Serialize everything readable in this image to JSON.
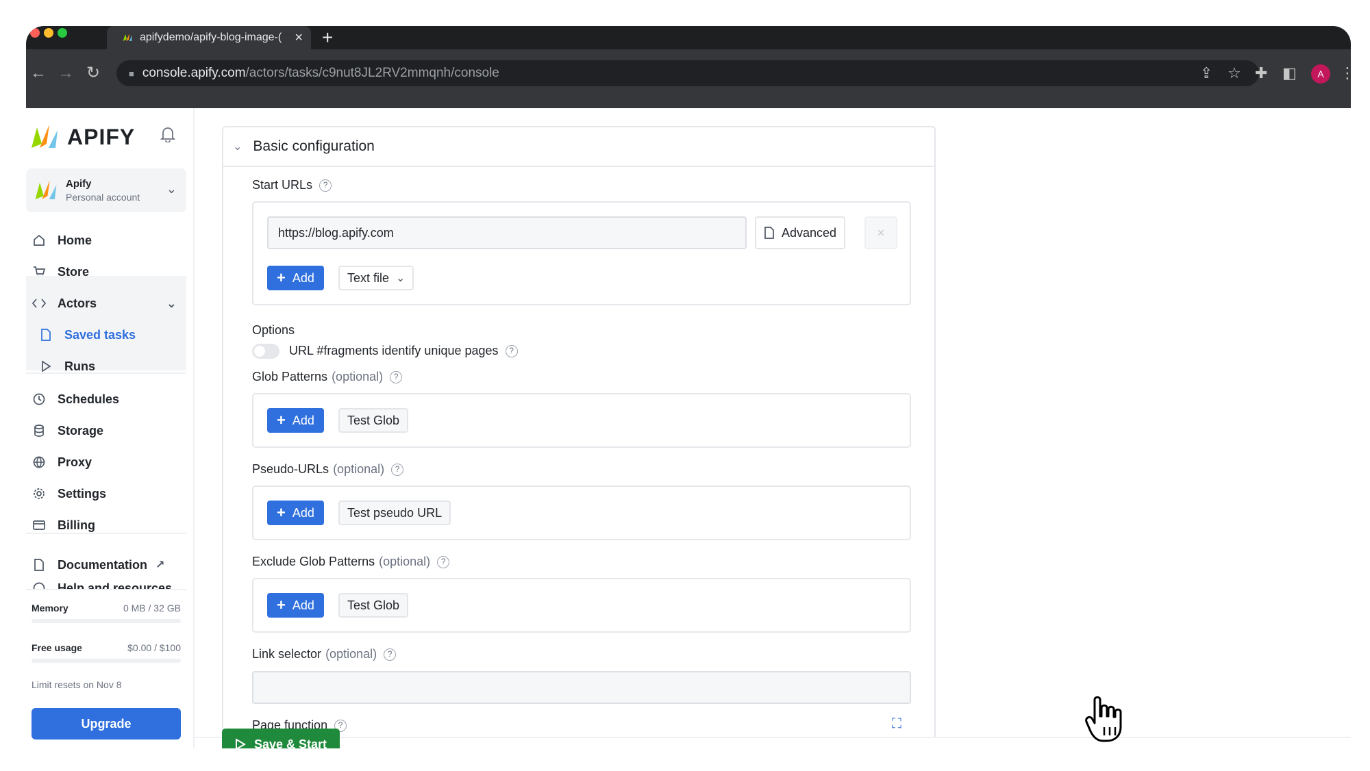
{
  "browser": {
    "tab_title": "apifydemo/apify-blog-image-(",
    "tab_close": "×",
    "new_tab": "+",
    "url_host": "console.apify.com",
    "url_path": "/actors/tasks/c9nut8JL2RV2mmqnh/console",
    "profile_initial": "A"
  },
  "sidebar": {
    "brand": "APIFY",
    "account": {
      "name": "Apify",
      "type": "Personal account"
    },
    "nav": [
      {
        "label": "Home",
        "icon": "home-icon"
      },
      {
        "label": "Store",
        "icon": "cart-icon"
      },
      {
        "label": "Actors",
        "icon": "code-icon"
      },
      {
        "label": "Saved tasks",
        "icon": "file-icon"
      },
      {
        "label": "Runs",
        "icon": "play-icon"
      },
      {
        "label": "Schedules",
        "icon": "clock-icon"
      },
      {
        "label": "Storage",
        "icon": "database-icon"
      },
      {
        "label": "Proxy",
        "icon": "globe-icon"
      },
      {
        "label": "Settings",
        "icon": "gear-icon"
      },
      {
        "label": "Billing",
        "icon": "card-icon"
      },
      {
        "label": "Documentation",
        "icon": "doc-icon"
      },
      {
        "label": "Help and resources",
        "icon": "help-icon"
      }
    ],
    "usage": {
      "memory_label": "Memory",
      "memory_value": "0 MB / 32 GB",
      "free_label": "Free usage",
      "free_value": "$0.00 / $100",
      "limit_text": "Limit resets on Nov 8"
    },
    "upgrade_label": "Upgrade",
    "collapse_glyph": "«"
  },
  "panel": {
    "title": "Basic configuration",
    "start_urls": {
      "label": "Start URLs",
      "value": "https://blog.apify.com",
      "advanced_label": "Advanced",
      "remove_glyph": "×",
      "add_label": "Add",
      "text_file_label": "Text file"
    },
    "options": {
      "label": "Options",
      "fragments_label": "URL #fragments identify unique pages",
      "fragments_enabled": false
    },
    "glob_patterns": {
      "label": "Glob Patterns",
      "optional": "(optional)",
      "add_label": "Add",
      "test_label": "Test Glob"
    },
    "pseudo_urls": {
      "label": "Pseudo-URLs",
      "optional": "(optional)",
      "add_label": "Add",
      "test_label": "Test pseudo URL"
    },
    "exclude_globs": {
      "label": "Exclude Glob Patterns",
      "optional": "(optional)",
      "add_label": "Add",
      "test_label": "Test Glob"
    },
    "link_selector": {
      "label": "Link selector",
      "optional": "(optional)",
      "value": ""
    },
    "page_function": {
      "label": "Page function"
    }
  },
  "footer": {
    "save_start_label": "Save & Start"
  },
  "colors": {
    "accent": "#2f6fde",
    "success": "#1f8a3b"
  }
}
